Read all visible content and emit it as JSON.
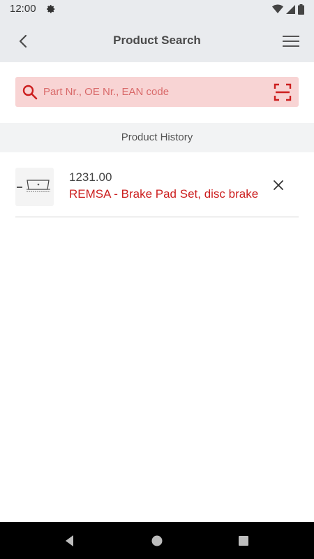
{
  "status_bar": {
    "time": "12:00",
    "icons": [
      "gear-icon",
      "wifi-icon",
      "signal-icon",
      "battery-icon"
    ]
  },
  "app_bar": {
    "title": "Product Search",
    "back_icon": "chevron-left-icon",
    "menu_icon": "hamburger-menu-icon"
  },
  "search": {
    "value": "",
    "placeholder": "Part Nr., OE Nr., EAN code",
    "search_icon": "search-icon",
    "scan_icon": "barcode-scan-icon"
  },
  "history": {
    "header": "Product History",
    "items": [
      {
        "number": "1231.00",
        "name": "REMSA - Brake Pad Set, disc brake",
        "remove_icon": "close-icon"
      }
    ]
  },
  "nav_bar": {
    "icons": [
      "back-triangle-icon",
      "home-circle-icon",
      "recents-square-icon"
    ]
  },
  "colors": {
    "accent": "#cc1f1f",
    "search_bg": "#f8d4d4",
    "app_bar_bg": "#e9ebee"
  }
}
